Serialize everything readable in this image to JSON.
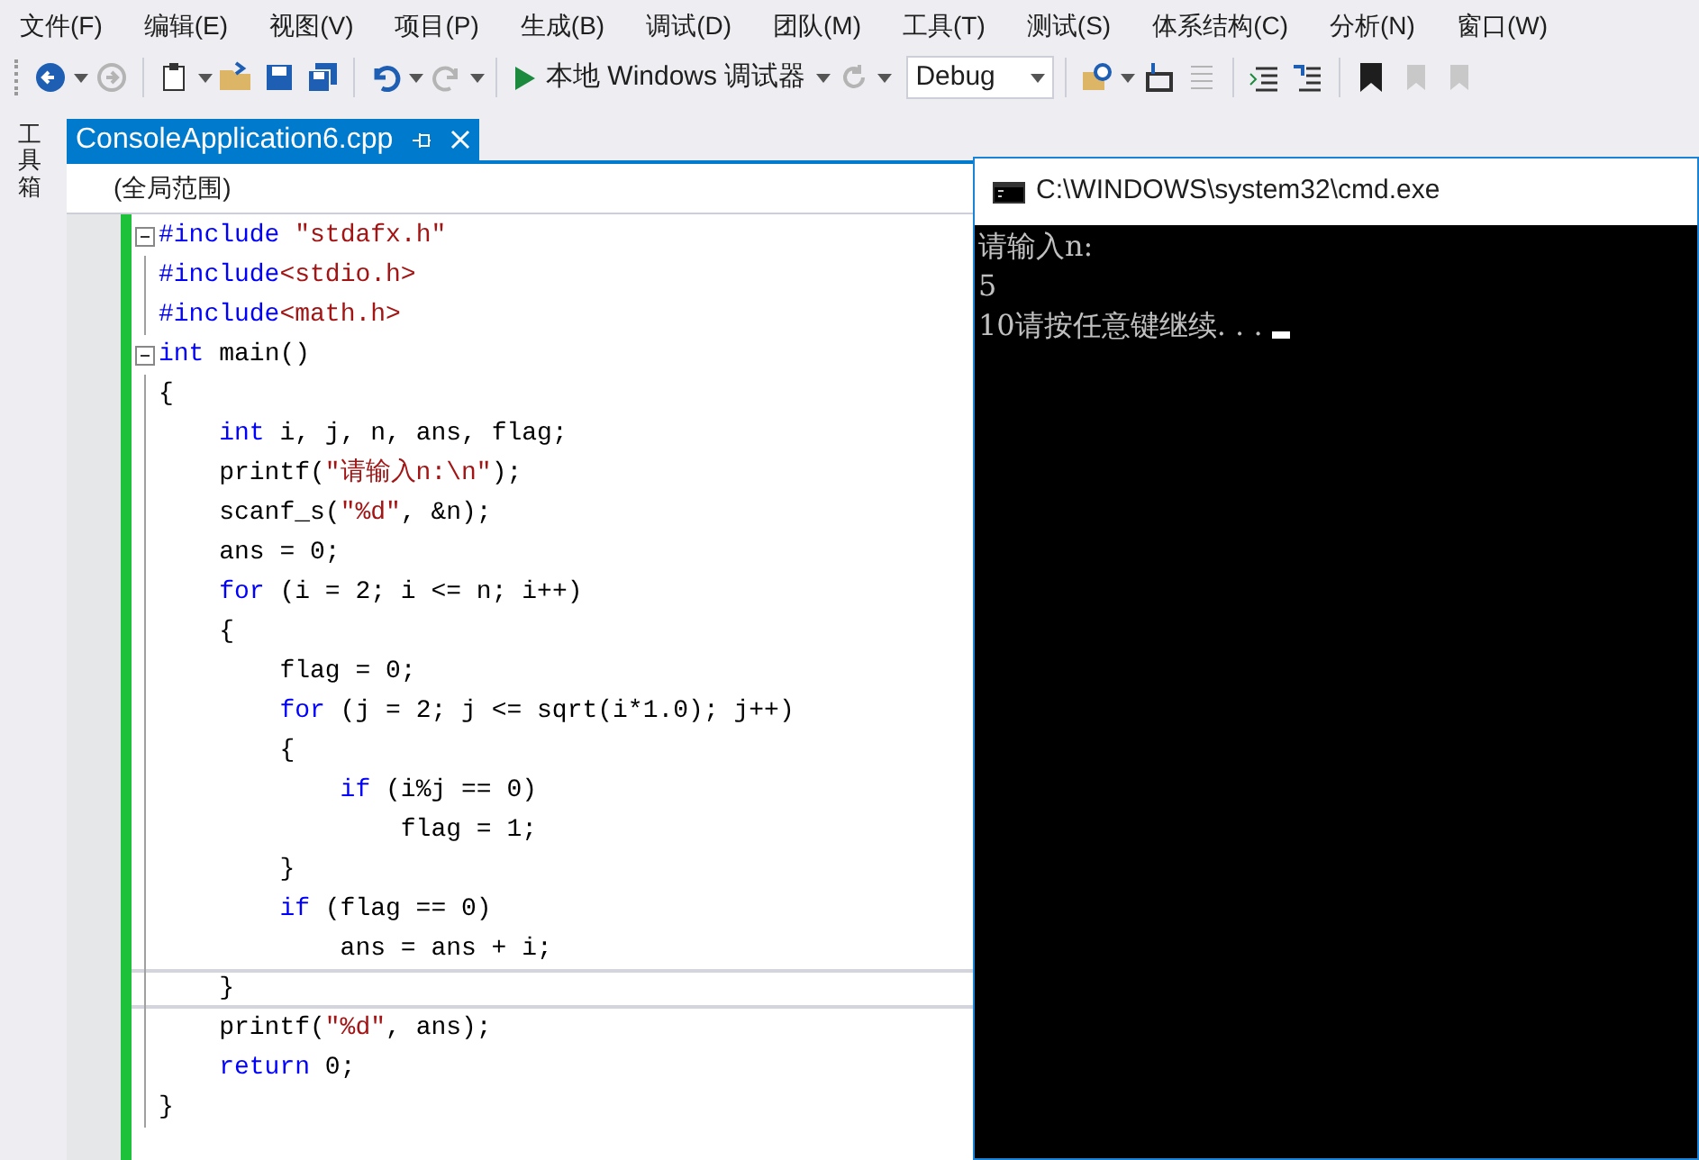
{
  "menu_bar": [
    {
      "label": "文件(F)"
    },
    {
      "label": "编辑(E)"
    },
    {
      "label": "视图(V)"
    },
    {
      "label": "项目(P)"
    },
    {
      "label": "生成(B)"
    },
    {
      "label": "调试(D)"
    },
    {
      "label": "团队(M)"
    },
    {
      "label": "工具(T)"
    },
    {
      "label": "测试(S)"
    },
    {
      "label": "体系结构(C)"
    },
    {
      "label": "分析(N)"
    },
    {
      "label": "窗口(W)"
    }
  ],
  "toolbar": {
    "debug_target": "本地 Windows 调试器",
    "configuration": "Debug"
  },
  "side_panel": {
    "label": "工具箱"
  },
  "editor": {
    "tab": {
      "title": "ConsoleApplication6.cpp",
      "selected": true
    },
    "scope": "(全局范围)",
    "lines": [
      {
        "foldable": true,
        "current": false,
        "tokens": [
          {
            "kind": "kw",
            "text": "#include"
          },
          {
            "kind": "str",
            "text": " \"stdafx.h\""
          }
        ]
      },
      {
        "foldable": false,
        "current": false,
        "tokens": [
          {
            "kind": "kw",
            "text": "#include"
          },
          {
            "kind": "str",
            "text": "<stdio.h>"
          }
        ]
      },
      {
        "foldable": false,
        "current": false,
        "tokens": [
          {
            "kind": "kw",
            "text": "#include"
          },
          {
            "kind": "str",
            "text": "<math.h>"
          }
        ]
      },
      {
        "foldable": true,
        "current": false,
        "tokens": [
          {
            "kind": "kw",
            "text": "int"
          },
          {
            "kind": "plain",
            "text": " main()"
          }
        ]
      },
      {
        "foldable": false,
        "current": false,
        "tokens": [
          {
            "kind": "plain",
            "text": "{"
          }
        ],
        "children": [
          {
            "foldable": false,
            "current": false,
            "tokens": [
              {
                "kind": "kw",
                "text": "int"
              },
              {
                "kind": "plain",
                "text": " i, j, n, ans, flag;"
              }
            ]
          },
          {
            "foldable": false,
            "current": false,
            "tokens": [
              {
                "kind": "plain",
                "text": "printf("
              },
              {
                "kind": "str",
                "text": "\"请输入n:\\n\""
              },
              {
                "kind": "plain",
                "text": ");"
              }
            ]
          },
          {
            "foldable": false,
            "current": false,
            "tokens": [
              {
                "kind": "plain",
                "text": "scanf_s("
              },
              {
                "kind": "str",
                "text": "\"%d\""
              },
              {
                "kind": "plain",
                "text": ", &n);"
              }
            ]
          },
          {
            "foldable": false,
            "current": false,
            "tokens": [
              {
                "kind": "plain",
                "text": "ans = 0;"
              }
            ]
          },
          {
            "foldable": false,
            "current": false,
            "tokens": [
              {
                "kind": "kw",
                "text": "for"
              },
              {
                "kind": "plain",
                "text": " (i = 2; i <= n; i++)"
              }
            ]
          },
          {
            "foldable": false,
            "current": false,
            "tokens": [
              {
                "kind": "plain",
                "text": "{"
              }
            ],
            "children": [
              {
                "foldable": false,
                "current": false,
                "tokens": [
                  {
                    "kind": "plain",
                    "text": "flag = 0;"
                  }
                ]
              },
              {
                "foldable": false,
                "current": false,
                "tokens": [
                  {
                    "kind": "kw",
                    "text": "for"
                  },
                  {
                    "kind": "plain",
                    "text": " (j = 2; j <= sqrt(i*1.0); j++)"
                  }
                ]
              },
              {
                "foldable": false,
                "current": false,
                "tokens": [
                  {
                    "kind": "plain",
                    "text": "{"
                  }
                ],
                "children": [
                  {
                    "foldable": false,
                    "current": false,
                    "tokens": [
                      {
                        "kind": "kw",
                        "text": "if"
                      },
                      {
                        "kind": "plain",
                        "text": " (i%j == 0)"
                      }
                    ],
                    "children": [
                      {
                        "foldable": false,
                        "current": false,
                        "tokens": [
                          {
                            "kind": "plain",
                            "text": "flag = 1;"
                          }
                        ]
                      }
                    ]
                  }
                ]
              },
              {
                "foldable": false,
                "current": false,
                "tokens": [
                  {
                    "kind": "plain",
                    "text": "}"
                  }
                ]
              },
              {
                "foldable": false,
                "current": false,
                "tokens": [
                  {
                    "kind": "kw",
                    "text": "if"
                  },
                  {
                    "kind": "plain",
                    "text": " (flag == 0)"
                  }
                ],
                "children": [
                  {
                    "foldable": false,
                    "current": false,
                    "tokens": [
                      {
                        "kind": "plain",
                        "text": "ans = ans + i;"
                      }
                    ]
                  }
                ]
              }
            ]
          },
          {
            "foldable": false,
            "current": true,
            "tokens": [
              {
                "kind": "plain",
                "text": "}"
              }
            ]
          },
          {
            "foldable": false,
            "current": false,
            "tokens": [
              {
                "kind": "plain",
                "text": "printf("
              },
              {
                "kind": "str",
                "text": "\"%d\""
              },
              {
                "kind": "plain",
                "text": ", ans);"
              }
            ]
          },
          {
            "foldable": false,
            "current": false,
            "tokens": [
              {
                "kind": "kw",
                "text": "return"
              },
              {
                "kind": "plain",
                "text": " 0;"
              }
            ]
          }
        ]
      },
      {
        "foldable": false,
        "current": false,
        "tokens": [
          {
            "kind": "plain",
            "text": "}"
          }
        ]
      }
    ]
  },
  "console": {
    "title": "C:\\WINDOWS\\system32\\cmd.exe",
    "lines": [
      "请输入n:",
      "5",
      "10请按任意键继续. . . "
    ]
  }
}
